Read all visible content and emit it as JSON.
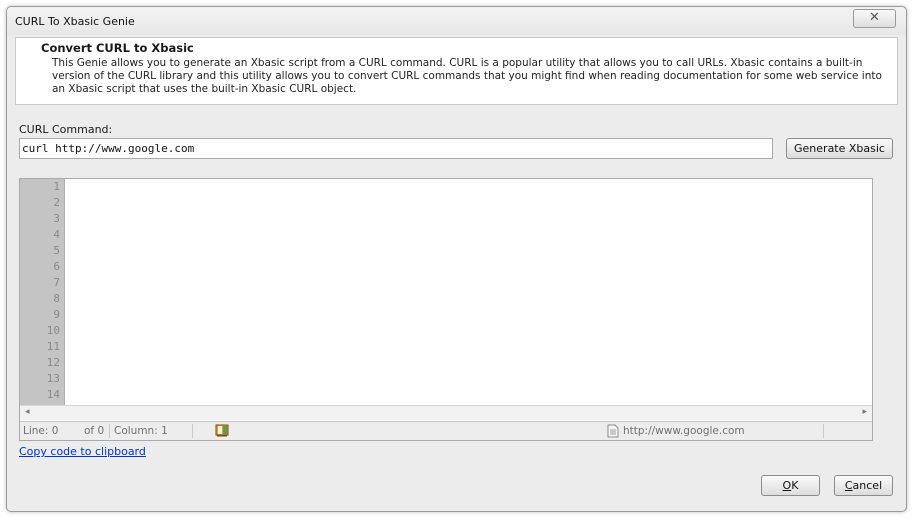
{
  "window": {
    "title": "CURL To Xbasic Genie",
    "close_symbol": "✕"
  },
  "header": {
    "title": "Convert CURL to Xbasic",
    "description": "This Genie allows you to generate an Xbasic script from a CURL command. CURL is a popular utility that allows you to call URLs. Xbasic contains a built-in version of the CURL library and this utility allows you to convert CURL commands that you might find when reading documentation for some web service into an Xbasic script that uses the built-in Xbasic CURL object."
  },
  "command": {
    "label": "CURL Command:",
    "value": "curl http://www.google.com",
    "generate_label": "Generate Xbasic"
  },
  "editor": {
    "line_numbers": [
      "1",
      "2",
      "3",
      "4",
      "5",
      "6",
      "7",
      "8",
      "9",
      "10",
      "11",
      "12",
      "13",
      "14"
    ],
    "scroll_left": "◂",
    "scroll_right": "▸"
  },
  "status": {
    "line": "Line: 0",
    "of": "of 0",
    "column": "Column: 1",
    "url": "http://www.google.com"
  },
  "copy_link": "Copy code to clipboard",
  "buttons": {
    "ok_accel": "O",
    "ok_rest": "K",
    "cancel_accel": "C",
    "cancel_rest": "ancel"
  },
  "icons": {
    "book": "book-icon",
    "document": "document-icon",
    "close": "close-icon"
  }
}
